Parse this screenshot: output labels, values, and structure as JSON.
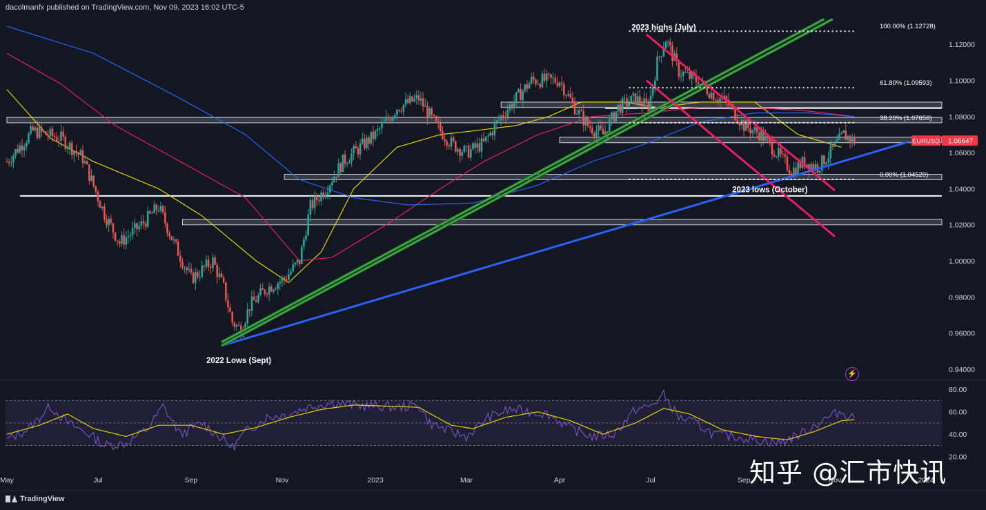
{
  "header": {
    "publisher": "dacolmanfx published on TradingView.com, Nov 09, 2023 16:02 UTC-5"
  },
  "footer": {
    "brand": "TradingView"
  },
  "watermark": "知乎 @汇市快讯",
  "chart_data": {
    "type": "candlestick",
    "symbol": "EURUSD",
    "last_price": "1.06647",
    "price_axis": {
      "ylim": [
        0.935,
        1.135
      ],
      "ticks": [
        1.12,
        1.1,
        1.08,
        1.06,
        1.04,
        1.02,
        1.0,
        0.98,
        0.96,
        0.94
      ],
      "tick_labels": [
        "1.12000",
        "1.10000",
        "1.08000",
        "1.06000",
        "1.04000",
        "1.02000",
        "1.00000",
        "0.98000",
        "0.96000",
        "0.94000"
      ]
    },
    "time_axis": {
      "xlim": [
        0,
        416
      ],
      "tick_labels": [
        {
          "label": "May",
          "t": 0
        },
        {
          "label": "Jul",
          "t": 42
        },
        {
          "label": "Sep",
          "t": 85
        },
        {
          "label": "Nov",
          "t": 127
        },
        {
          "label": "2023",
          "t": 170
        },
        {
          "label": "Mar",
          "t": 212
        },
        {
          "label": "Apr",
          "t": 255
        },
        {
          "label": "Jul",
          "t": 297
        },
        {
          "label": "Sep",
          "t": 340
        },
        {
          "label": "Nov",
          "t": 382
        },
        {
          "label": "2024",
          "t": 424
        }
      ]
    },
    "price_path": [
      {
        "t": 0,
        "p": 1.055
      },
      {
        "t": 12,
        "p": 1.072
      },
      {
        "t": 25,
        "p": 1.068
      },
      {
        "t": 35,
        "p": 1.057
      },
      {
        "t": 45,
        "p": 1.026
      },
      {
        "t": 52,
        "p": 1.01
      },
      {
        "t": 62,
        "p": 1.02
      },
      {
        "t": 70,
        "p": 1.03
      },
      {
        "t": 77,
        "p": 1.01
      },
      {
        "t": 85,
        "p": 0.99
      },
      {
        "t": 95,
        "p": 1.0
      },
      {
        "t": 100,
        "p": 0.985
      },
      {
        "t": 104,
        "p": 0.966
      },
      {
        "t": 108,
        "p": 0.962
      },
      {
        "t": 112,
        "p": 0.975
      },
      {
        "t": 120,
        "p": 0.985
      },
      {
        "t": 128,
        "p": 0.99
      },
      {
        "t": 135,
        "p": 1.0
      },
      {
        "t": 140,
        "p": 1.03
      },
      {
        "t": 147,
        "p": 1.04
      },
      {
        "t": 155,
        "p": 1.055
      },
      {
        "t": 162,
        "p": 1.062
      },
      {
        "t": 170,
        "p": 1.07
      },
      {
        "t": 180,
        "p": 1.085
      },
      {
        "t": 190,
        "p": 1.09
      },
      {
        "t": 198,
        "p": 1.075
      },
      {
        "t": 205,
        "p": 1.065
      },
      {
        "t": 212,
        "p": 1.06
      },
      {
        "t": 220,
        "p": 1.065
      },
      {
        "t": 228,
        "p": 1.08
      },
      {
        "t": 235,
        "p": 1.09
      },
      {
        "t": 242,
        "p": 1.1
      },
      {
        "t": 250,
        "p": 1.1
      },
      {
        "t": 255,
        "p": 1.1
      },
      {
        "t": 262,
        "p": 1.085
      },
      {
        "t": 268,
        "p": 1.075
      },
      {
        "t": 275,
        "p": 1.07
      },
      {
        "t": 282,
        "p": 1.085
      },
      {
        "t": 290,
        "p": 1.09
      },
      {
        "t": 296,
        "p": 1.085
      },
      {
        "t": 300,
        "p": 1.11
      },
      {
        "t": 304,
        "p": 1.123
      },
      {
        "t": 310,
        "p": 1.105
      },
      {
        "t": 318,
        "p": 1.1
      },
      {
        "t": 325,
        "p": 1.093
      },
      {
        "t": 332,
        "p": 1.088
      },
      {
        "t": 340,
        "p": 1.075
      },
      {
        "t": 348,
        "p": 1.07
      },
      {
        "t": 355,
        "p": 1.06
      },
      {
        "t": 362,
        "p": 1.05
      },
      {
        "t": 368,
        "p": 1.055
      },
      {
        "t": 374,
        "p": 1.052
      },
      {
        "t": 380,
        "p": 1.06
      },
      {
        "t": 386,
        "p": 1.07
      },
      {
        "t": 391,
        "p": 1.0665
      }
    ],
    "moving_averages": [
      {
        "name": "MA50",
        "color": "#e6d200",
        "points": [
          {
            "t": 0,
            "p": 1.095
          },
          {
            "t": 20,
            "p": 1.068
          },
          {
            "t": 40,
            "p": 1.055
          },
          {
            "t": 70,
            "p": 1.04
          },
          {
            "t": 90,
            "p": 1.025
          },
          {
            "t": 115,
            "p": 1.0
          },
          {
            "t": 130,
            "p": 0.988
          },
          {
            "t": 145,
            "p": 1.005
          },
          {
            "t": 160,
            "p": 1.04
          },
          {
            "t": 180,
            "p": 1.063
          },
          {
            "t": 200,
            "p": 1.07
          },
          {
            "t": 215,
            "p": 1.072
          },
          {
            "t": 235,
            "p": 1.075
          },
          {
            "t": 250,
            "p": 1.08
          },
          {
            "t": 265,
            "p": 1.088
          },
          {
            "t": 285,
            "p": 1.088
          },
          {
            "t": 300,
            "p": 1.085
          },
          {
            "t": 320,
            "p": 1.088
          },
          {
            "t": 345,
            "p": 1.088
          },
          {
            "t": 365,
            "p": 1.07
          },
          {
            "t": 385,
            "p": 1.063
          }
        ]
      },
      {
        "name": "MA100",
        "color": "#e91e63",
        "points": [
          {
            "t": 0,
            "p": 1.115
          },
          {
            "t": 25,
            "p": 1.098
          },
          {
            "t": 50,
            "p": 1.075
          },
          {
            "t": 80,
            "p": 1.055
          },
          {
            "t": 110,
            "p": 1.035
          },
          {
            "t": 135,
            "p": 1.0
          },
          {
            "t": 150,
            "p": 1.002
          },
          {
            "t": 175,
            "p": 1.02
          },
          {
            "t": 200,
            "p": 1.04
          },
          {
            "t": 220,
            "p": 1.055
          },
          {
            "t": 245,
            "p": 1.07
          },
          {
            "t": 270,
            "p": 1.08
          },
          {
            "t": 295,
            "p": 1.082
          },
          {
            "t": 320,
            "p": 1.085
          },
          {
            "t": 345,
            "p": 1.085
          },
          {
            "t": 370,
            "p": 1.083
          },
          {
            "t": 391,
            "p": 1.08
          }
        ]
      },
      {
        "name": "MA200",
        "color": "#2962ff",
        "points": [
          {
            "t": 0,
            "p": 1.13
          },
          {
            "t": 40,
            "p": 1.115
          },
          {
            "t": 80,
            "p": 1.09
          },
          {
            "t": 110,
            "p": 1.07
          },
          {
            "t": 135,
            "p": 1.045
          },
          {
            "t": 160,
            "p": 1.035
          },
          {
            "t": 185,
            "p": 1.031
          },
          {
            "t": 215,
            "p": 1.032
          },
          {
            "t": 245,
            "p": 1.042
          },
          {
            "t": 270,
            "p": 1.055
          },
          {
            "t": 295,
            "p": 1.065
          },
          {
            "t": 320,
            "p": 1.077
          },
          {
            "t": 345,
            "p": 1.082
          },
          {
            "t": 370,
            "p": 1.082
          },
          {
            "t": 391,
            "p": 1.08
          }
        ]
      }
    ],
    "horizontal_zones": [
      {
        "t0": 0,
        "t1": 416,
        "p": 1.078,
        "h": 0.0015
      },
      {
        "t0": 228,
        "t1": 416,
        "p": 1.0865,
        "h": 0.0015
      },
      {
        "t0": 128,
        "t1": 416,
        "p": 1.0465,
        "h": 0.0015
      },
      {
        "t0": 81,
        "t1": 416,
        "p": 1.0215,
        "h": 0.0015
      },
      {
        "t0": 255,
        "t1": 416,
        "p": 1.067,
        "h": 0.0015
      }
    ],
    "support_lines": [
      {
        "name": "black-solid-1.036",
        "t0": 6,
        "t1": 416,
        "p0": 1.036,
        "p1": 1.036,
        "color": "#ffffff",
        "width": 2
      },
      {
        "name": "1.0845-line",
        "t0": 276,
        "t1": 416,
        "p0": 1.0845,
        "p1": 1.0845,
        "color": "#ffffff",
        "width": 1.5
      }
    ],
    "trendlines": [
      {
        "name": "blue-trendline",
        "t0": 99,
        "p0": 0.953,
        "t1": 416,
        "p1": 1.066,
        "color": "#2962ff",
        "width": 3
      },
      {
        "name": "green-trendline-1",
        "t0": 99,
        "p0": 0.955,
        "t1": 377,
        "p1": 1.134,
        "color": "#4caf50",
        "width": 2
      },
      {
        "name": "green-trendline-2",
        "t0": 99,
        "p0": 0.953,
        "t1": 381,
        "p1": 1.134,
        "color": "#4caf50",
        "width": 2
      },
      {
        "name": "channel-upper",
        "t0": 295,
        "p0": 1.1255,
        "t1": 382,
        "p1": 1.039,
        "color": "#e91e63",
        "width": 3
      },
      {
        "name": "channel-lower",
        "t0": 295,
        "p0": 1.1,
        "t1": 382,
        "p1": 1.0135,
        "color": "#e91e63",
        "width": 3
      }
    ],
    "fibonacci": [
      {
        "label": "100.00% (1.12728)",
        "value": 1.12728
      },
      {
        "label": "61.80% (1.09593)",
        "value": 1.09593
      },
      {
        "label": "38.20% (1.07656)",
        "value": 1.07656
      },
      {
        "label": "0.00% (1.04520)",
        "value": 1.0452
      }
    ],
    "fib_range_t": [
      287,
      392
    ],
    "annotations": [
      {
        "text": "2023 highs (July)",
        "t": 303,
        "p": 1.1295
      },
      {
        "text": "2022 Lows (Sept)",
        "t": 107,
        "p": 0.945
      },
      {
        "text": "2023 lows (October)",
        "t": 352,
        "p": 1.0395
      }
    ],
    "rsi": {
      "ylim": [
        10,
        85
      ],
      "ticks": [
        80,
        60,
        40,
        20
      ],
      "tick_labels": [
        "80.00",
        "60.00",
        "40.00",
        "20.00"
      ],
      "band": [
        30,
        70
      ],
      "line_color": "#7e57c2",
      "signal_color": "#e6d200",
      "values": [
        {
          "t": 0,
          "v": 35
        },
        {
          "t": 10,
          "v": 45
        },
        {
          "t": 20,
          "v": 65
        },
        {
          "t": 28,
          "v": 50
        },
        {
          "t": 38,
          "v": 40
        },
        {
          "t": 45,
          "v": 30
        },
        {
          "t": 55,
          "v": 32
        },
        {
          "t": 65,
          "v": 45
        },
        {
          "t": 72,
          "v": 65
        },
        {
          "t": 80,
          "v": 40
        },
        {
          "t": 90,
          "v": 50
        },
        {
          "t": 98,
          "v": 38
        },
        {
          "t": 104,
          "v": 28
        },
        {
          "t": 110,
          "v": 42
        },
        {
          "t": 120,
          "v": 55
        },
        {
          "t": 130,
          "v": 58
        },
        {
          "t": 140,
          "v": 65
        },
        {
          "t": 150,
          "v": 68
        },
        {
          "t": 160,
          "v": 66
        },
        {
          "t": 170,
          "v": 65
        },
        {
          "t": 180,
          "v": 64
        },
        {
          "t": 190,
          "v": 66
        },
        {
          "t": 195,
          "v": 50
        },
        {
          "t": 205,
          "v": 42
        },
        {
          "t": 212,
          "v": 38
        },
        {
          "t": 222,
          "v": 55
        },
        {
          "t": 232,
          "v": 62
        },
        {
          "t": 242,
          "v": 60
        },
        {
          "t": 250,
          "v": 58
        },
        {
          "t": 260,
          "v": 45
        },
        {
          "t": 270,
          "v": 38
        },
        {
          "t": 280,
          "v": 40
        },
        {
          "t": 290,
          "v": 62
        },
        {
          "t": 297,
          "v": 65
        },
        {
          "t": 303,
          "v": 75
        },
        {
          "t": 310,
          "v": 55
        },
        {
          "t": 318,
          "v": 50
        },
        {
          "t": 326,
          "v": 40
        },
        {
          "t": 336,
          "v": 38
        },
        {
          "t": 346,
          "v": 35
        },
        {
          "t": 356,
          "v": 32
        },
        {
          "t": 366,
          "v": 40
        },
        {
          "t": 376,
          "v": 52
        },
        {
          "t": 384,
          "v": 60
        },
        {
          "t": 391,
          "v": 55
        }
      ],
      "signal": [
        {
          "t": 0,
          "v": 40
        },
        {
          "t": 15,
          "v": 48
        },
        {
          "t": 28,
          "v": 58
        },
        {
          "t": 40,
          "v": 45
        },
        {
          "t": 55,
          "v": 38
        },
        {
          "t": 70,
          "v": 48
        },
        {
          "t": 85,
          "v": 48
        },
        {
          "t": 100,
          "v": 40
        },
        {
          "t": 115,
          "v": 46
        },
        {
          "t": 130,
          "v": 55
        },
        {
          "t": 145,
          "v": 62
        },
        {
          "t": 160,
          "v": 66
        },
        {
          "t": 175,
          "v": 65
        },
        {
          "t": 190,
          "v": 64
        },
        {
          "t": 205,
          "v": 48
        },
        {
          "t": 215,
          "v": 45
        },
        {
          "t": 230,
          "v": 55
        },
        {
          "t": 245,
          "v": 60
        },
        {
          "t": 260,
          "v": 52
        },
        {
          "t": 275,
          "v": 40
        },
        {
          "t": 290,
          "v": 50
        },
        {
          "t": 303,
          "v": 63
        },
        {
          "t": 315,
          "v": 58
        },
        {
          "t": 330,
          "v": 44
        },
        {
          "t": 346,
          "v": 38
        },
        {
          "t": 360,
          "v": 35
        },
        {
          "t": 372,
          "v": 42
        },
        {
          "t": 385,
          "v": 52
        },
        {
          "t": 391,
          "v": 53
        }
      ]
    },
    "colors": {
      "up": "#26a69a",
      "down": "#ef5350",
      "bg": "#131722",
      "grid": "#1f2330",
      "axis_text": "#d1d4dc",
      "price_tag": "#f23645"
    }
  }
}
